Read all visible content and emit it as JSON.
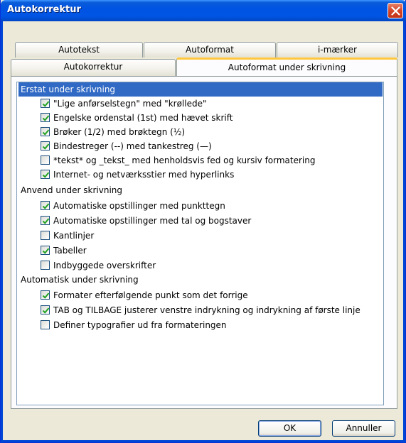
{
  "window": {
    "title": "Autokorrektur"
  },
  "tabs": {
    "row1": [
      "Autotekst",
      "Autoformat",
      "i-mærker"
    ],
    "row2": [
      "Autokorrektur",
      "Autoformat under skrivning"
    ],
    "active": "Autoformat under skrivning"
  },
  "sections": [
    {
      "title": "Erstat under skrivning",
      "selected": true,
      "items": [
        {
          "label": "\"Lige anførselstegn\" med \"krøllede\"",
          "checked": true
        },
        {
          "label": "Engelske ordenstal (1st) med hævet skrift",
          "checked": true
        },
        {
          "label": "Brøker (1/2) med brøktegn (½)",
          "checked": true
        },
        {
          "label": "Bindestreger (--) med tankestreg (—)",
          "checked": true
        },
        {
          "label": "*tekst* og _tekst_ med henholdsvis fed og kursiv formatering",
          "checked": false
        },
        {
          "label": "Internet- og netværksstier med hyperlinks",
          "checked": true
        }
      ]
    },
    {
      "title": "Anvend under skrivning",
      "selected": false,
      "items": [
        {
          "label": "Automatiske opstillinger med punkttegn",
          "checked": true
        },
        {
          "label": "Automatiske opstillinger med tal og bogstaver",
          "checked": true
        },
        {
          "label": "Kantlinjer",
          "checked": false
        },
        {
          "label": "Tabeller",
          "checked": true
        },
        {
          "label": "Indbyggede overskrifter",
          "checked": false
        }
      ]
    },
    {
      "title": "Automatisk under skrivning",
      "selected": false,
      "items": [
        {
          "label": "Formater efterfølgende punkt som det forrige",
          "checked": true
        },
        {
          "label": "TAB og TILBAGE justerer venstre indrykning og indrykning af første linje",
          "checked": true
        },
        {
          "label": "Definer typografier ud fra formateringen",
          "checked": false
        }
      ]
    }
  ],
  "buttons": {
    "ok": "OK",
    "cancel": "Annuller"
  },
  "colors": {
    "titlebar": "#0054e3",
    "selection": "#316ac5",
    "active_tab_accent": "#ffc83c",
    "check": "#21a121"
  }
}
